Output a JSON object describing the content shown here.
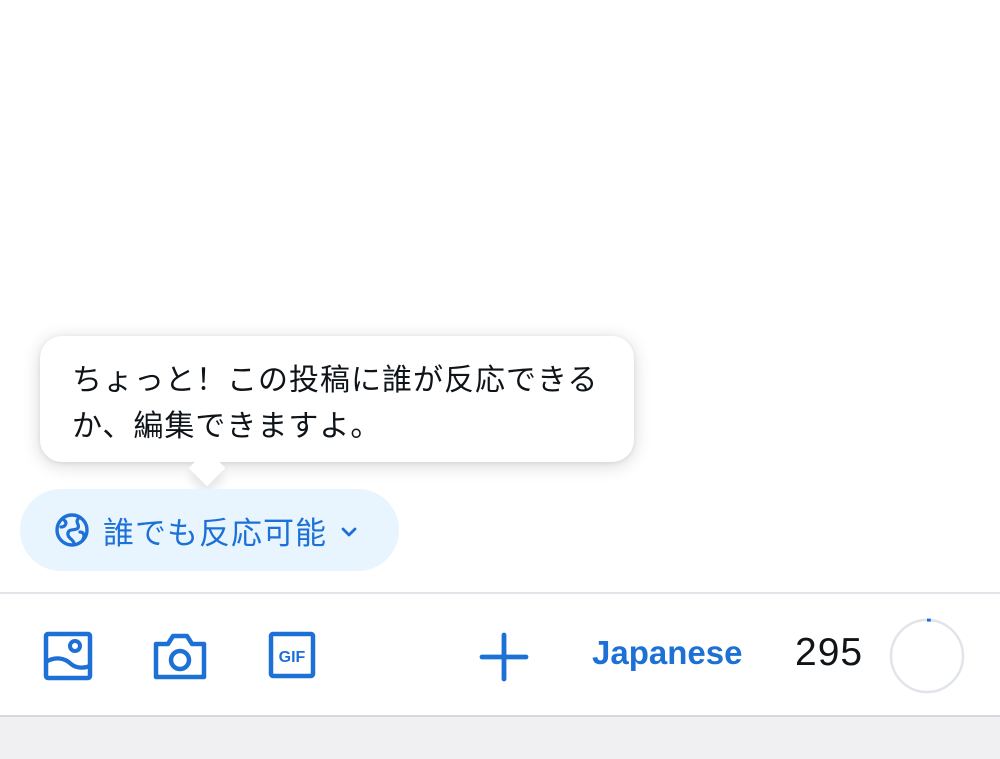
{
  "tooltip": {
    "message": "ちょっと！この投稿に誰が反応できるか、編集できますよ。"
  },
  "reply_setting": {
    "icon": "globe-icon",
    "label": "誰でも反応可能",
    "chevron": "chevron-down-icon"
  },
  "toolbar": {
    "icons": [
      "image-icon",
      "camera-icon",
      "gif-icon",
      "plus-icon"
    ],
    "gif_label": "GIF",
    "language": "Japanese",
    "remaining_chars": "295",
    "progress": 0.017
  },
  "colors": {
    "accent": "#1d71d6",
    "pill_bg": "#e8f5fe",
    "text": "#0f1419",
    "divider": "#e1e4e8",
    "ring_track": "#e1e4e8",
    "bottom_bar": "#f0f0f2"
  }
}
